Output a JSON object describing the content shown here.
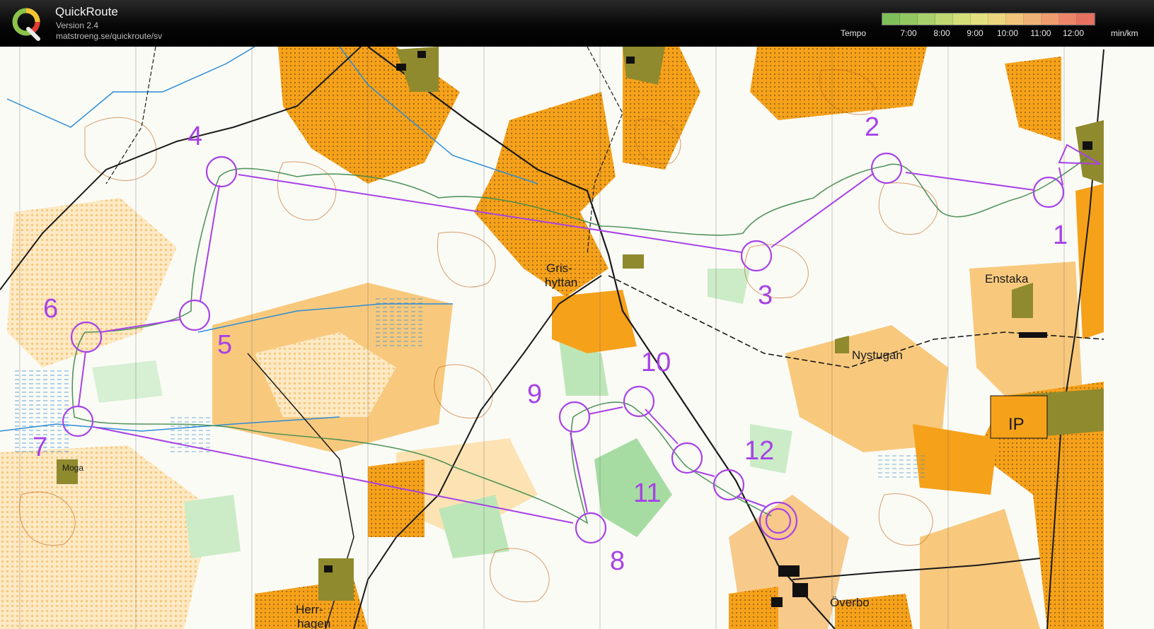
{
  "app": {
    "title": "QuickRoute",
    "version": "Version 2.4",
    "url": "matstroeng.se/quickroute/sv"
  },
  "tempo": {
    "label": "Tempo",
    "unit": "min/km",
    "ticks": [
      "7:00",
      "8:00",
      "9:00",
      "10:00",
      "11:00",
      "12:00"
    ],
    "colors": [
      "#7fbf5a",
      "#92c762",
      "#a8d06d",
      "#bfd873",
      "#d4df7a",
      "#e3e07f",
      "#ecd57f",
      "#f1c47b",
      "#f1b276",
      "#ef9c70",
      "#ec8569",
      "#e87060"
    ]
  },
  "colors": {
    "course": "#a742e6",
    "yellow": "#f6a11a",
    "light_yellow": "#f8c97d",
    "green": "#a6dca2",
    "olive": "#8f8a2e",
    "contour": "#c46a1e",
    "route": "#3f8a4e"
  },
  "map": {
    "place_names": [
      "Gris-",
      "hyttan",
      "Enstaka",
      "Nystugan",
      "IP",
      "Moga",
      "Herr-",
      "hagen",
      "Överbo"
    ],
    "controls": [
      "1",
      "2",
      "3",
      "4",
      "5",
      "6",
      "7",
      "8",
      "9",
      "10",
      "11",
      "12"
    ]
  }
}
